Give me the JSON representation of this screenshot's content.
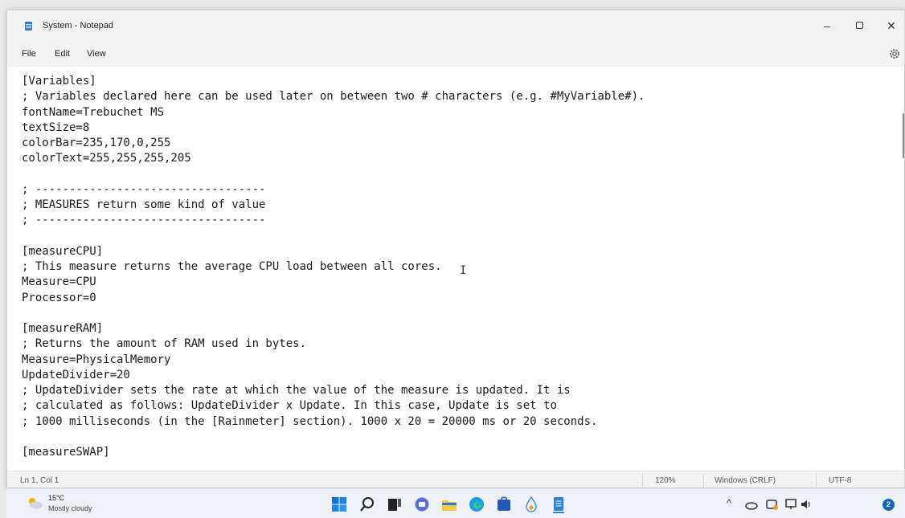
{
  "window": {
    "title": "System - Notepad"
  },
  "menu": {
    "file": "File",
    "edit": "Edit",
    "view": "View"
  },
  "editor": {
    "lines": [
      "[Variables]",
      "; Variables declared here can be used later on between two # characters (e.g. #MyVariable#).",
      "fontName=Trebuchet MS",
      "textSize=8",
      "colorBar=235,170,0,255",
      "colorText=255,255,255,205",
      "",
      "; ----------------------------------",
      "; MEASURES return some kind of value",
      "; ----------------------------------",
      "",
      "[measureCPU]",
      "; This measure returns the average CPU load between all cores.",
      "Measure=CPU",
      "Processor=0",
      "",
      "[measureRAM]",
      "; Returns the amount of RAM used in bytes.",
      "Measure=PhysicalMemory",
      "UpdateDivider=20",
      "; UpdateDivider sets the rate at which the value of the measure is updated. It is",
      "; calculated as follows: UpdateDivider x Update. In this case, Update is set to",
      "; 1000 milliseconds (in the [Rainmeter] section). 1000 x 20 = 20000 ms or 20 seconds.",
      "",
      "[measureSWAP]"
    ]
  },
  "status": {
    "position": "Ln 1, Col 1",
    "zoom": "120%",
    "line_ending": "Windows (CRLF)",
    "encoding": "UTF-8"
  },
  "taskbar": {
    "weather_temp": "15°C",
    "weather_desc": "Mostly cloudy",
    "notification_count": "2",
    "apps": [
      "start-icon",
      "search-icon",
      "task-view-icon",
      "chat-icon",
      "file-explorer-icon",
      "edge-icon",
      "store-icon",
      "droplet-icon",
      "notepad-icon"
    ]
  },
  "colors": {
    "accent": "#0067c0",
    "titlebar": "#f3f3f3",
    "editor_bg": "#ffffff"
  }
}
